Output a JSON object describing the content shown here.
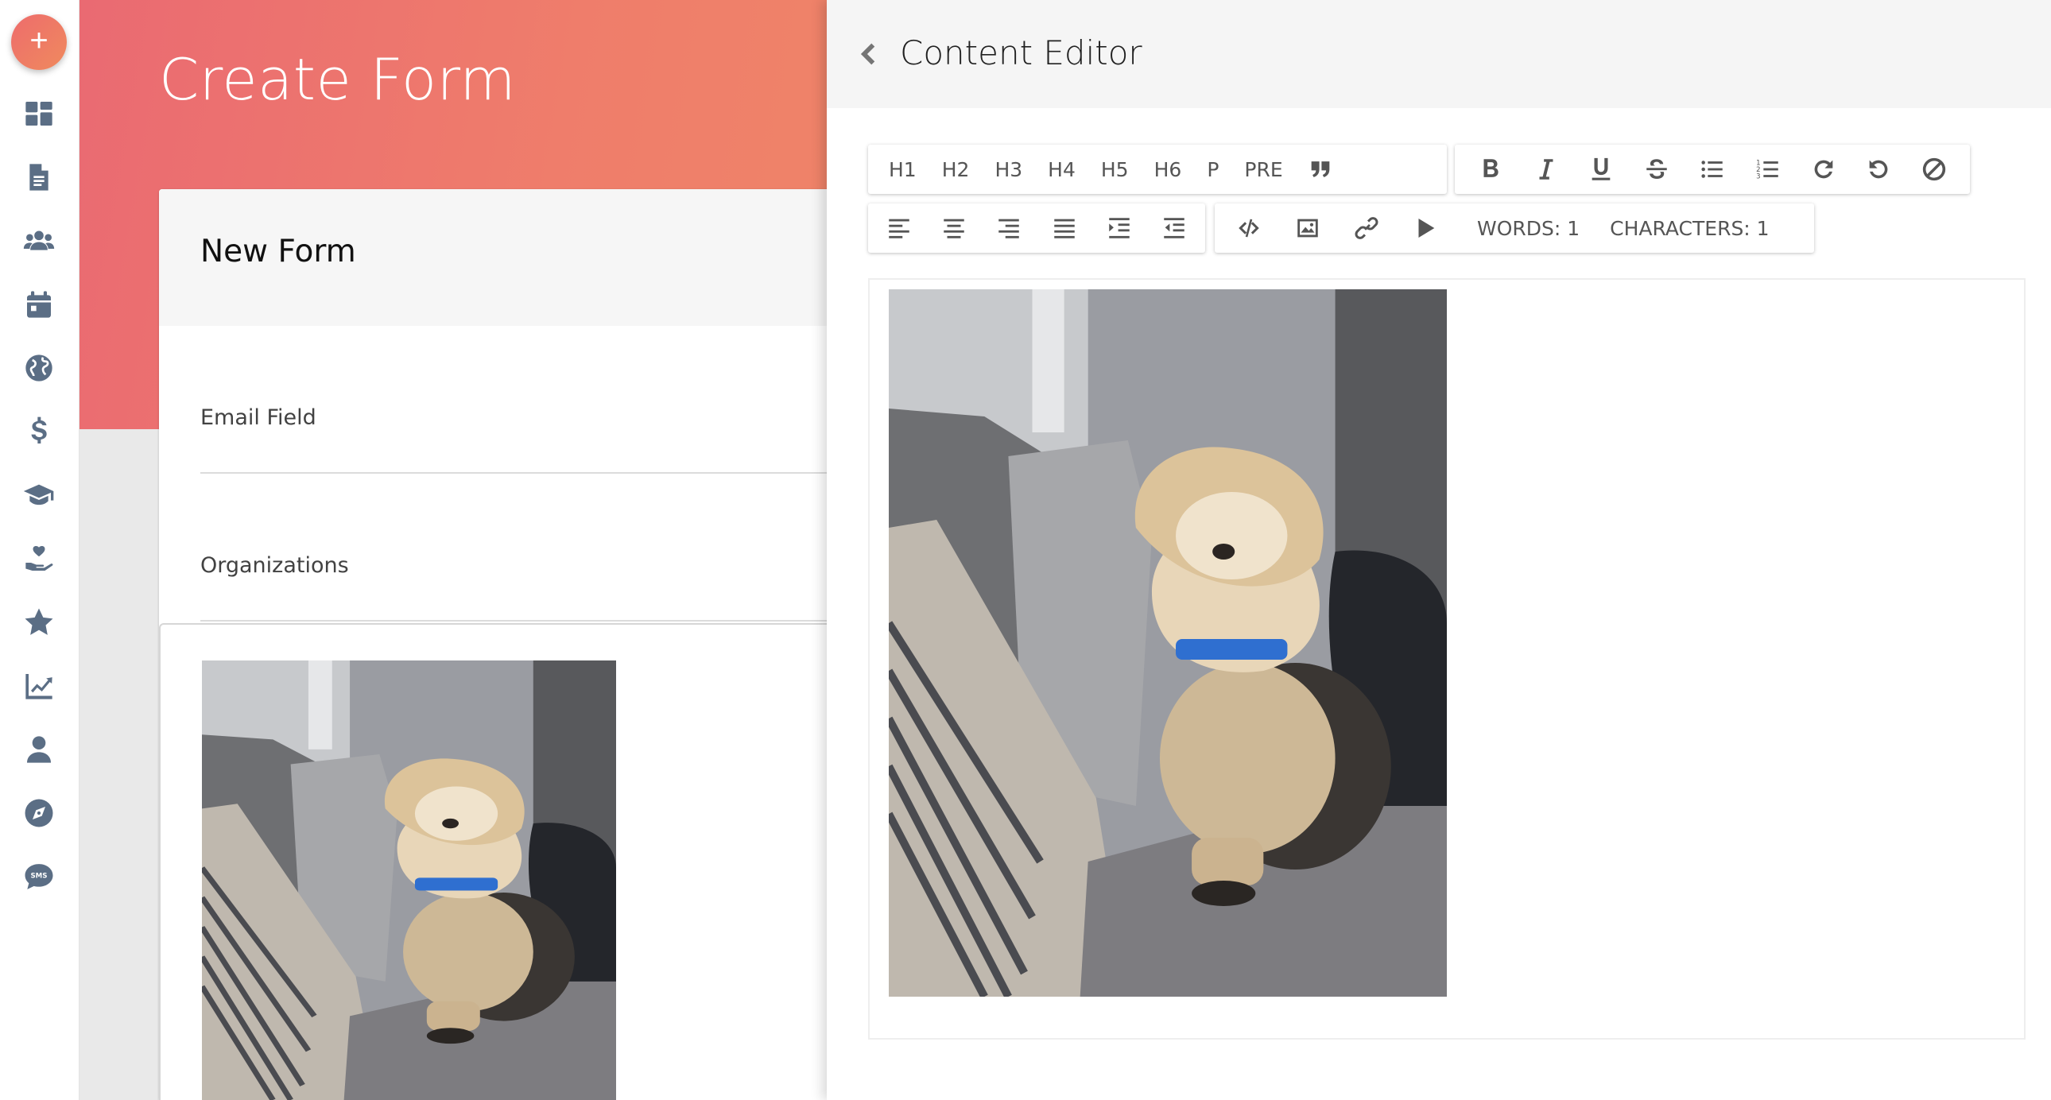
{
  "rail": {
    "fab_symbol": "+",
    "items": [
      {
        "icon": "dashboard-icon"
      },
      {
        "icon": "document-icon"
      },
      {
        "icon": "users-icon"
      },
      {
        "icon": "calendar-icon"
      },
      {
        "icon": "globe-icon"
      },
      {
        "icon": "dollar-icon"
      },
      {
        "icon": "graduation-cap-icon"
      },
      {
        "icon": "hand-heart-icon"
      },
      {
        "icon": "star-icon"
      },
      {
        "icon": "chart-line-icon"
      },
      {
        "icon": "user-icon"
      },
      {
        "icon": "compass-icon"
      },
      {
        "icon": "sms-icon"
      }
    ]
  },
  "page": {
    "title": "Create Form",
    "card_title": "New Form",
    "fields": [
      "Email Field",
      "Organizations"
    ]
  },
  "editor": {
    "title": "Content Editor",
    "toolbar_headings": [
      "H1",
      "H2",
      "H3",
      "H4",
      "H5",
      "H6",
      "P",
      "PRE"
    ],
    "word_count": "WORDS: 1",
    "char_count": "CHARACTERS: 1"
  },
  "colors": {
    "accent_start": "#ea6a72",
    "accent_end": "#ef8468",
    "rail_icon": "#5b6e85"
  }
}
